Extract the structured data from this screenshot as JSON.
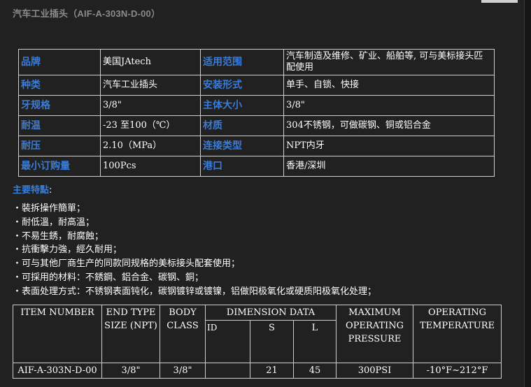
{
  "page_title": "汽车工业插头（AIF-A-303N-D-00）",
  "spec_table": [
    [
      {
        "k": "品牌",
        "v": "美国JAtech"
      },
      {
        "k": "适用范围",
        "v": "汽车制造及维修、矿业、船舶等, 可与美标接头匹配使用"
      }
    ],
    [
      {
        "k": "种类",
        "v": "汽车工业插头"
      },
      {
        "k": "安装形式",
        "v": "单手、自锁、快接"
      }
    ],
    [
      {
        "k": "牙规格",
        "v": "3/8\""
      },
      {
        "k": "主体大小",
        "v": "3/8\""
      }
    ],
    [
      {
        "k": "耐温",
        "v": "-23 至100（℃）"
      },
      {
        "k": "材质",
        "v": "304不锈钢，可做碳钢、铜或铝合金"
      }
    ],
    [
      {
        "k": "耐压",
        "v": "2.10（MPa）"
      },
      {
        "k": "连接类型",
        "v": "NPT内牙"
      }
    ],
    [
      {
        "k": "最小订购量",
        "v": "100Pcs"
      },
      {
        "k": "港口",
        "v": "香港/深圳"
      }
    ]
  ],
  "features": {
    "title": "主要特點",
    "colon": ":",
    "items": [
      "裝拆操作簡單；",
      "耐低溫，耐高溫；",
      "不易生銹，耐腐蝕；",
      "抗衝擊力強，經久耐用；",
      "可与其他厂商生产的同款同规格的美标接头配套使用；",
      "可採用的材料：不銹鋼、鋁合金、碳钢、銅；",
      "表面处理方式：不锈钢表面钝化，碳钢镀锌或镀镍，铝做阳极氧化或硬质阳极氧化处理；"
    ]
  },
  "item_table": {
    "headers": {
      "item_number": "ITEM NUMBER",
      "end_type": "END TYPE SIZE (NPT)",
      "body_class": "BODY CLASS",
      "dimension": "DIMENSION DATA",
      "max_pressure": "MAXIMUM OPERATING PRESSURE",
      "op_temp": "OPERATING TEMPERATURE",
      "id": "ID",
      "s": "S",
      "l": "L"
    },
    "rows": [
      {
        "item": "AIF-A-303N-D-00",
        "end": "3/8\"",
        "body": "3/8\"",
        "id": "",
        "s": "21",
        "l": "45",
        "pressure": "300PSI",
        "temp": "-10°F~212°F"
      }
    ]
  }
}
